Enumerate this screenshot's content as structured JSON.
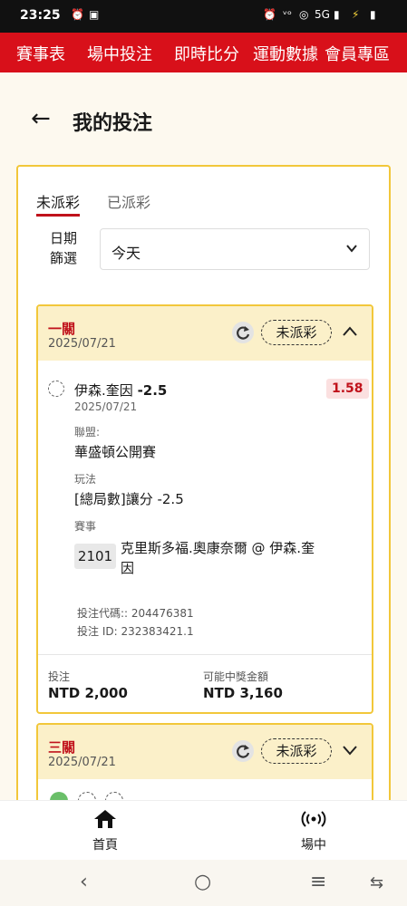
{
  "status_bar": {
    "time": "23:25",
    "network": "5G"
  },
  "top_nav": {
    "items": [
      "賽事表",
      "場中投注",
      "即時比分",
      "運動數據",
      "會員專區"
    ]
  },
  "page": {
    "title": "我的投注"
  },
  "tabs": {
    "unsettled": "未派彩",
    "settled": "已派彩"
  },
  "filter": {
    "label_line1": "日期",
    "label_line2": "篩選",
    "value": "今天"
  },
  "bets": [
    {
      "type": "一關",
      "date": "2025/07/21",
      "status": "未派彩",
      "selection_name": "伊森.奎因",
      "selection_line": "-2.5",
      "odds": "1.58",
      "selection_date": "2025/07/21",
      "league_label": "聯盟:",
      "league": "華盛頓公開賽",
      "market_label": "玩法",
      "market": "[總局數]讓分 -2.5",
      "event_label": "賽事",
      "event_id": "2101",
      "event_name": "克里斯多福.奧康奈爾 @ 伊森.奎因",
      "bet_code": "投注代碼:: 204476381",
      "bet_id": "投注 ID: 232383421.1",
      "stake_label": "投注",
      "stake": "NTD 2,000",
      "payout_label": "可能中獎金額",
      "payout": "NTD 3,160"
    },
    {
      "type": "三關",
      "date": "2025/07/21",
      "status": "未派彩"
    }
  ],
  "bottom_nav": {
    "home": "首頁",
    "live": "場中"
  },
  "colors": {
    "brand_red": "#d8101a",
    "accent_yellow": "#f2c73a",
    "odds_red": "#c0121b"
  }
}
